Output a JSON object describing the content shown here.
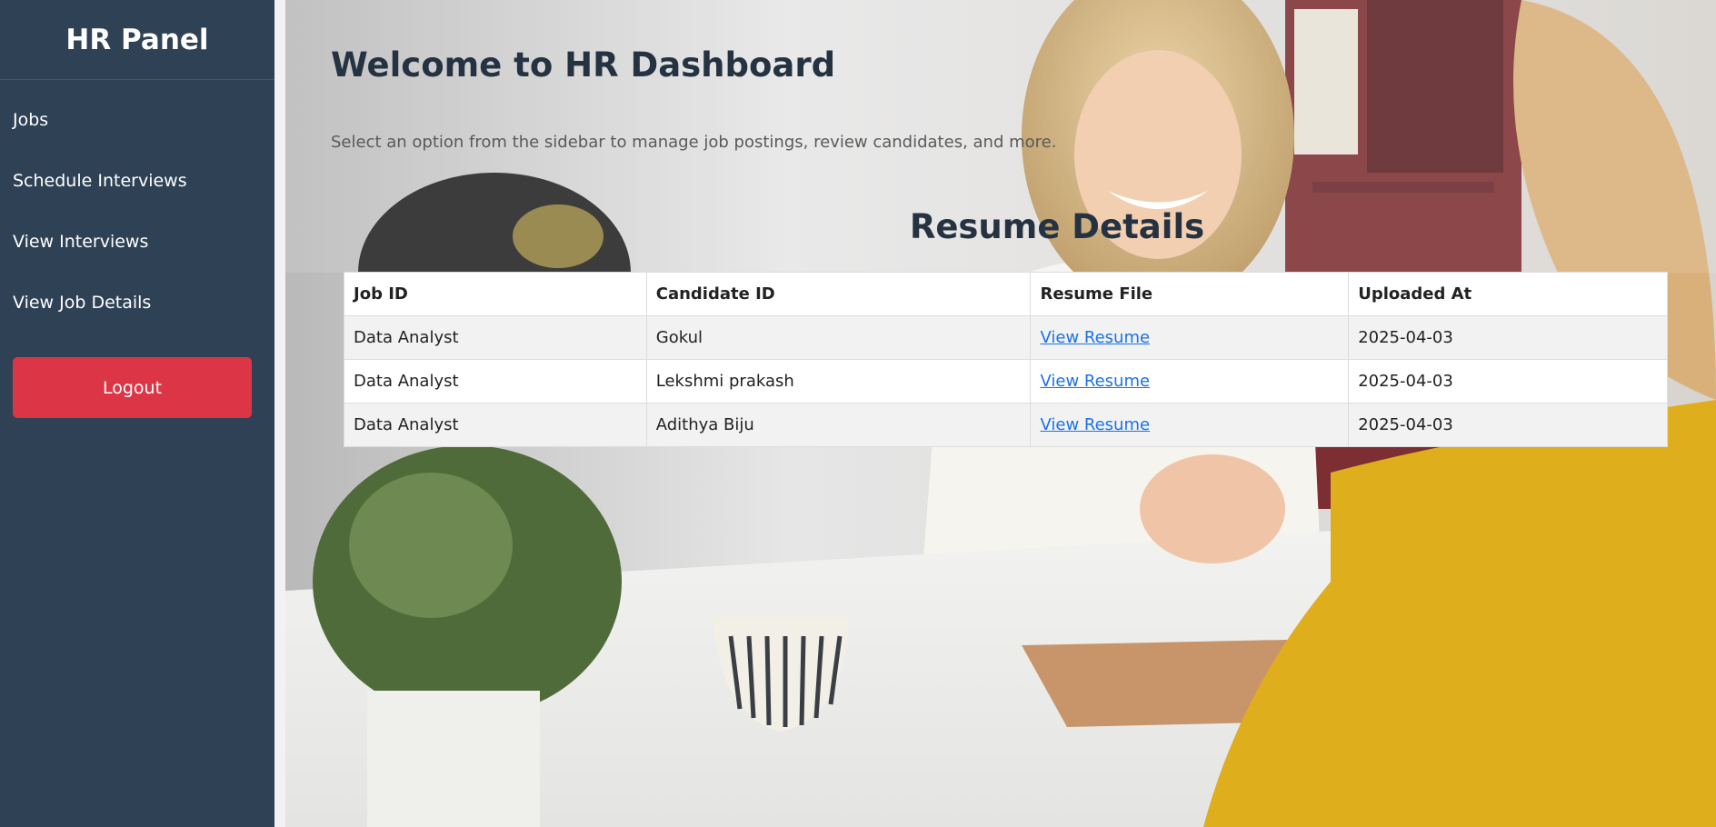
{
  "sidebar": {
    "title": "HR Panel",
    "items": [
      {
        "label": "Jobs"
      },
      {
        "label": "Schedule Interviews"
      },
      {
        "label": "View Interviews"
      },
      {
        "label": "View Job Details"
      }
    ],
    "logout_label": "Logout"
  },
  "main": {
    "welcome_title": "Welcome to HR Dashboard",
    "welcome_subtitle": "Select an option from the sidebar to manage job postings, review candidates, and more.",
    "section_title": "Resume Details",
    "table": {
      "headers": [
        "Job ID",
        "Candidate ID",
        "Resume File",
        "Uploaded At"
      ],
      "rows": [
        {
          "job_id": "Data Analyst",
          "candidate_id": "Gokul",
          "resume_link": "View Resume",
          "uploaded_at": "2025-04-03"
        },
        {
          "job_id": "Data Analyst",
          "candidate_id": "Lekshmi prakash",
          "resume_link": "View Resume",
          "uploaded_at": "2025-04-03"
        },
        {
          "job_id": "Data Analyst",
          "candidate_id": "Adithya Biju",
          "resume_link": "View Resume",
          "uploaded_at": "2025-04-03"
        }
      ]
    }
  },
  "colors": {
    "sidebar_bg": "#2e4155",
    "logout_bg": "#dc3545",
    "link": "#1a73e8",
    "heading": "#253241"
  }
}
